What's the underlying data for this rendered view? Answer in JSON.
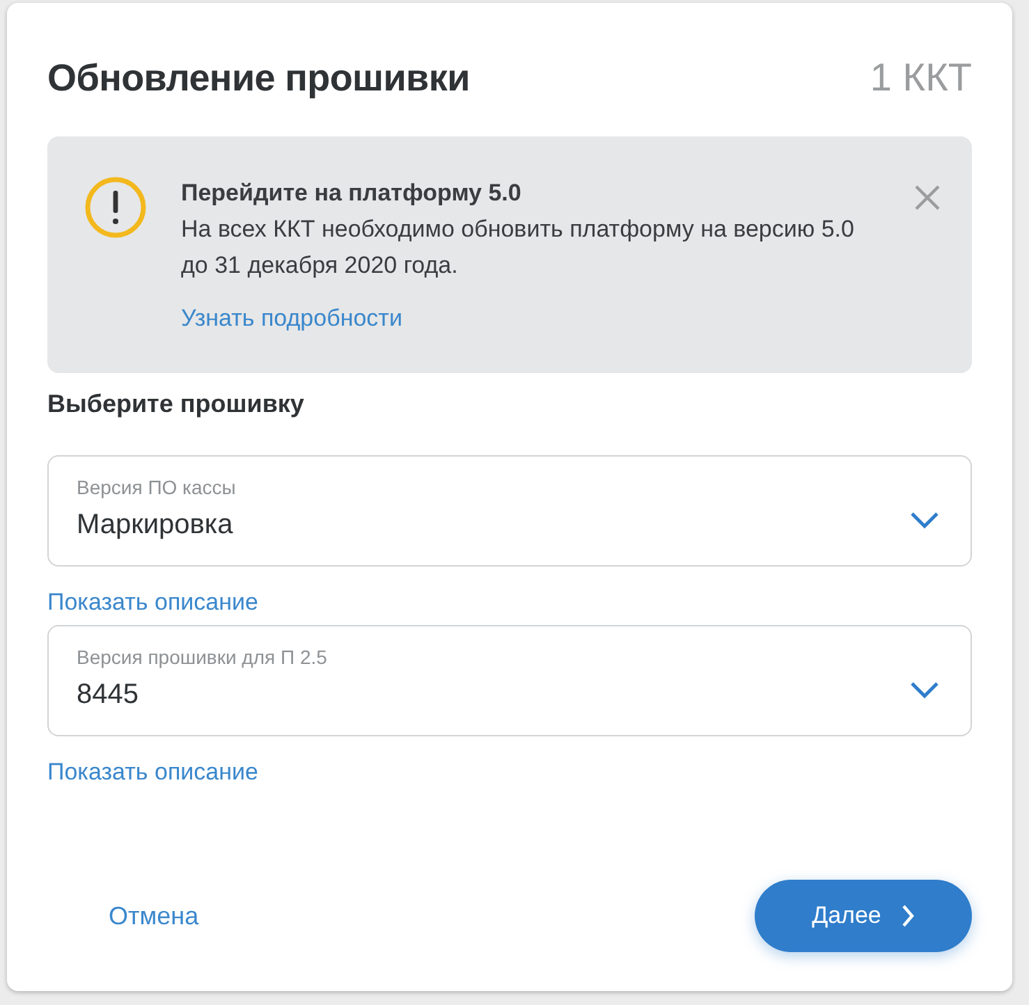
{
  "dialog": {
    "title": "Обновление прошивки",
    "count": "1 ККТ"
  },
  "alert": {
    "title": "Перейдите на платформу 5.0",
    "message": "На всех ККТ необходимо обновить платформу на версию 5.0 до 31 декабря 2020 года.",
    "link": "Узнать подробности"
  },
  "section_title": "Выберите прошивку",
  "selects": [
    {
      "label": "Версия ПО кассы",
      "value": "Маркировка",
      "link": "Показать описание"
    },
    {
      "label": "Версия прошивки для П 2.5",
      "value": "8445",
      "link": "Показать описание"
    }
  ],
  "buttons": {
    "cancel": "Отмена",
    "next": "Далее"
  }
}
